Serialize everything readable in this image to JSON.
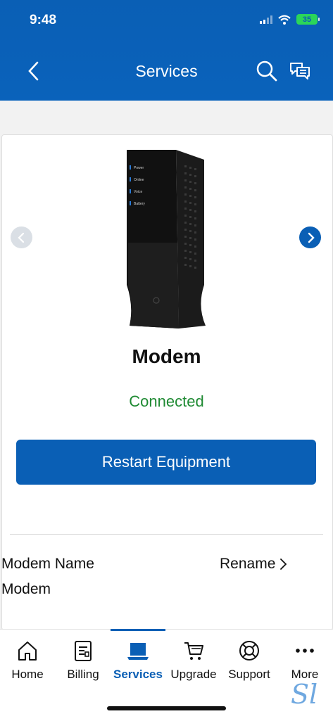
{
  "status_bar": {
    "time": "9:48",
    "battery": "35"
  },
  "header": {
    "title": "Services"
  },
  "device": {
    "name": "Modem",
    "status": "Connected",
    "status_color": "#1f8a33"
  },
  "actions": {
    "restart_label": "Restart Equipment"
  },
  "details": {
    "name_label": "Modem Name",
    "name_value": "Modem",
    "rename_label": "Rename"
  },
  "tabs": [
    {
      "label": "Home",
      "icon": "home-icon"
    },
    {
      "label": "Billing",
      "icon": "bill-icon"
    },
    {
      "label": "Services",
      "icon": "laptop-icon"
    },
    {
      "label": "Upgrade",
      "icon": "cart-icon"
    },
    {
      "label": "Support",
      "icon": "lifebuoy-icon"
    },
    {
      "label": "More",
      "icon": "more-icon"
    }
  ],
  "active_tab": "Services",
  "colors": {
    "brand": "#0a5fb5",
    "status_connected": "#1f8a33"
  }
}
